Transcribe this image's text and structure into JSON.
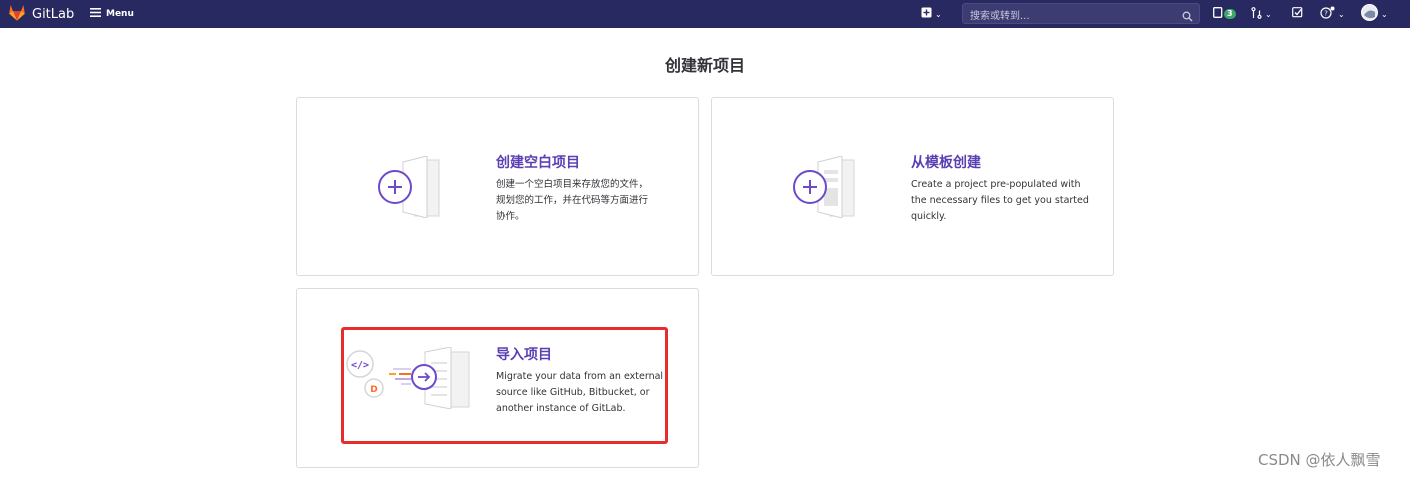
{
  "navbar": {
    "brand": "GitLab",
    "menu_label": "Menu",
    "search_placeholder": "搜索或转到...",
    "issues_badge": "3"
  },
  "page": {
    "title": "创建新项目"
  },
  "cards": [
    {
      "title": "创建空白项目",
      "desc_lines": [
        "创建一个空白项目来存放您的文件，",
        "规划您的工作，并在代码等方面进行",
        "协作。"
      ]
    },
    {
      "title": "从模板创建",
      "desc_lines": [
        "Create a project pre-populated with",
        "the necessary files to get you started",
        "quickly."
      ]
    },
    {
      "title": "导入项目",
      "desc_lines": [
        "Migrate your data from an external",
        "source like GitHub, Bitbucket, or",
        "another instance of GitLab."
      ]
    }
  ],
  "watermark": "CSDN @依人飘雪",
  "colors": {
    "navbar": "#292961",
    "accent": "#5b3fb3",
    "highlight": "#e62c2c"
  }
}
